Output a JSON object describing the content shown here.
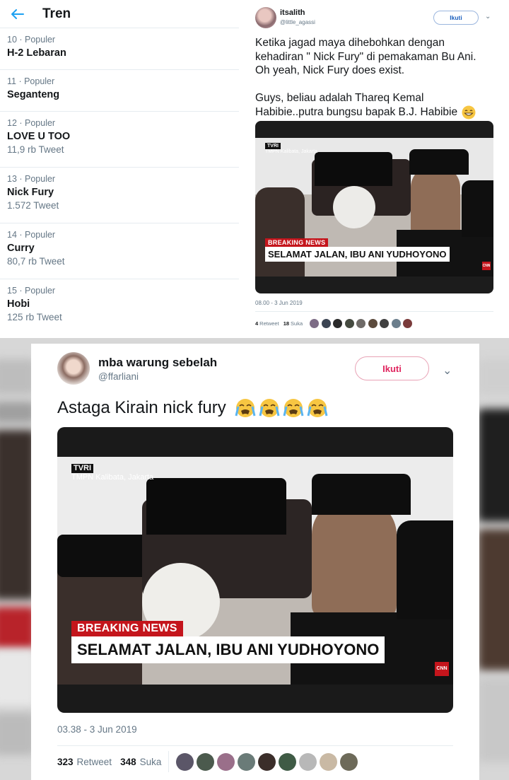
{
  "trends": {
    "title": "Tren",
    "items": [
      {
        "meta": "10 · Populer",
        "name": "H-2 Lebaran",
        "count": ""
      },
      {
        "meta": "11 · Populer",
        "name": "Seganteng",
        "count": ""
      },
      {
        "meta": "12 · Populer",
        "name": "LOVE U TOO",
        "count": "11,9 rb Tweet"
      },
      {
        "meta": "13 · Populer",
        "name": "Nick Fury",
        "count": "1.572 Tweet"
      },
      {
        "meta": "14 · Populer",
        "name": "Curry",
        "count": "80,7 rb Tweet"
      },
      {
        "meta": "15 · Populer",
        "name": "Hobi",
        "count": "125 rb Tweet"
      }
    ]
  },
  "tweet_small": {
    "name": "itsalith",
    "handle": "@little_agassi",
    "follow_label": "Ikuti",
    "chevron": "⌄",
    "text_line1": "Ketika jagad maya dihebohkan dengan",
    "text_line2": "kehadiran \" Nick Fury\" di pemakaman Bu Ani.",
    "text_line3": "Oh yeah, Nick Fury does exist.",
    "text_line4": "Guys, beliau adalah Thareq Kemal",
    "text_line5": "Habibie..putra bungsu bapak B.J. Habibie",
    "date": "08.00 - 3 Jun 2019",
    "retweets": "4",
    "retweet_label": "Retweet",
    "likes": "18",
    "like_label": "Suka"
  },
  "tweet_big": {
    "name": "mba warung sebelah",
    "handle": "@ffarliani",
    "follow_label": "Ikuti",
    "chevron": "⌄",
    "text": "Astaga Kirain nick fury",
    "date": "03.38 - 3 Jun 2019",
    "retweets": "323",
    "retweet_label": "Retweet",
    "likes": "348",
    "like_label": "Suka"
  },
  "news_frame": {
    "channel": "TVRI",
    "location": "TMPN Kalibata, Jakarta",
    "breaking": "BREAKING NEWS",
    "headline": "SELAMAT JALAN, IBU ANI YUDHOYONO",
    "network": "CNN"
  },
  "colors": {
    "twitter_blue": "#1da1f2",
    "follow_pink": "#e0245e",
    "breaking_red": "#c4151c"
  }
}
